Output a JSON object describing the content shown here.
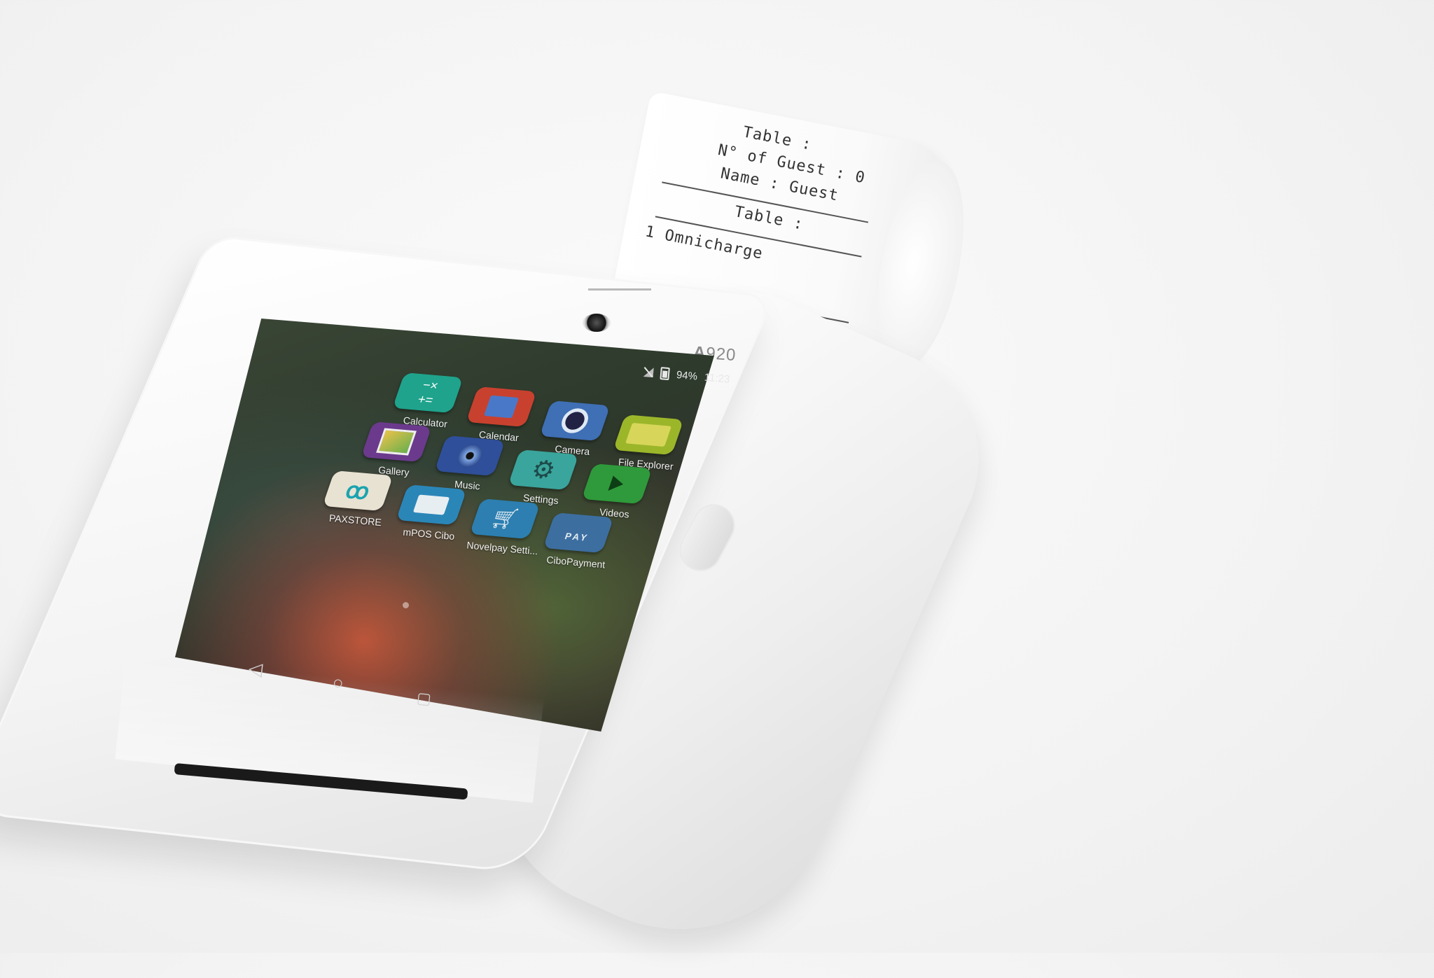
{
  "device": {
    "model_label_a": "A",
    "model_label_num": "920"
  },
  "status_bar": {
    "battery": "94%",
    "time": "11:23"
  },
  "apps": [
    {
      "label": "Calculator",
      "color": "#1fa38c",
      "icon": "calculator-icon"
    },
    {
      "label": "Calendar",
      "color": "#c8412f",
      "icon": "calendar-icon"
    },
    {
      "label": "Camera",
      "color": "#3f6fb5",
      "icon": "camera-icon"
    },
    {
      "label": "File Explorer",
      "color": "#9cb62a",
      "icon": "folder-icon"
    },
    {
      "label": "Gallery",
      "color": "#6b3a8c",
      "icon": "gallery-icon"
    },
    {
      "label": "Music",
      "color": "#2f4f9a",
      "icon": "music-icon"
    },
    {
      "label": "Settings",
      "color": "#3aa59c",
      "icon": "gear-icon"
    },
    {
      "label": "Videos",
      "color": "#2f9a3b",
      "icon": "play-icon"
    },
    {
      "label": "PAXSTORE",
      "color": "#e8e2d2",
      "icon": "paxstore-icon"
    },
    {
      "label": "mPOS Cibo",
      "color": "#2b86b8",
      "icon": "mpos-icon"
    },
    {
      "label": "Novelpay Setti...",
      "color": "#2c7fb0",
      "icon": "cart-icon"
    },
    {
      "label": "CiboPayment",
      "color": "#3d6ea0",
      "icon": "pay-icon"
    }
  ],
  "app_glyphs": {
    "pay_text": "PAY"
  },
  "receipt": {
    "lines": [
      "Table :",
      "N° of Guest : 0",
      "Name : Guest",
      "Table :",
      "1 Omnicharge"
    ]
  }
}
